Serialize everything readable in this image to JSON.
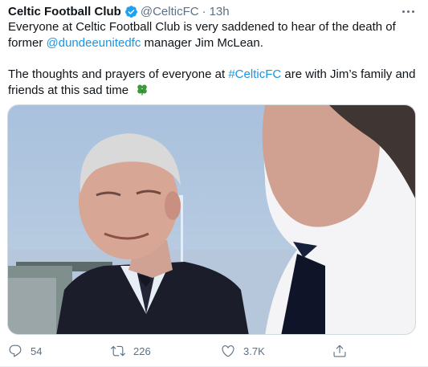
{
  "tweet": {
    "author": "Celtic Football Club",
    "handle": "@CelticFC",
    "separator": "·",
    "time": "13h",
    "line1": "Everyone at Celtic Football Club is very saddened to hear of the death of",
    "line2_pre": "former ",
    "mention": "@dundeeunitedfc",
    "line2_post": " manager Jim McLean.",
    "line3_pre": "The thoughts and prayers of everyone at ",
    "hashtag": "#CelticFC",
    "line3_post": " are with Jim’s family and",
    "line4": "friends at this sad time"
  },
  "icons": {
    "verified": "verified-badge-icon",
    "more": "more-options-icon",
    "clover": "shamrock-emoji-icon",
    "reply": "reply-icon",
    "retweet": "retweet-icon",
    "like": "like-icon",
    "share": "share-icon"
  },
  "actions": {
    "replies": "54",
    "retweets": "226",
    "likes": "3.7K"
  },
  "colors": {
    "link": "#1b95e0",
    "muted": "#5b7083",
    "verified": "#1da1f2",
    "clover": "#3a9b3a"
  }
}
